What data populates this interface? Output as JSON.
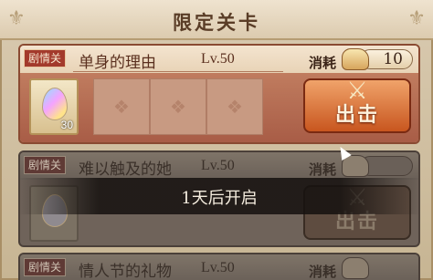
{
  "header": {
    "title": "限定关卡"
  },
  "stages": [
    {
      "tag": "剧情关",
      "name": "单身的理由",
      "level": "Lv.50",
      "cost_label": "消耗",
      "cost": "10",
      "reward_count": "30",
      "button": "出击",
      "locked": false
    },
    {
      "tag": "剧情关",
      "name": "难以触及的她",
      "level": "Lv.50",
      "cost_label": "消耗",
      "cost": "",
      "reward_count": "",
      "button": "出击",
      "locked": true,
      "lock_text": "1天后开启"
    },
    {
      "tag": "剧情关",
      "name": "情人节的礼物",
      "level": "Lv.50",
      "cost_label": "消耗",
      "locked": true
    }
  ],
  "colors": {
    "active_card": "#c07c5f",
    "locked_card": "#6f635a",
    "button": "#c8561f"
  },
  "icons": {
    "header_decor": "fleur-icon",
    "cost": "bread-icon",
    "reward": "rainbow-gem-icon",
    "button": "crossed-swords-icon"
  }
}
